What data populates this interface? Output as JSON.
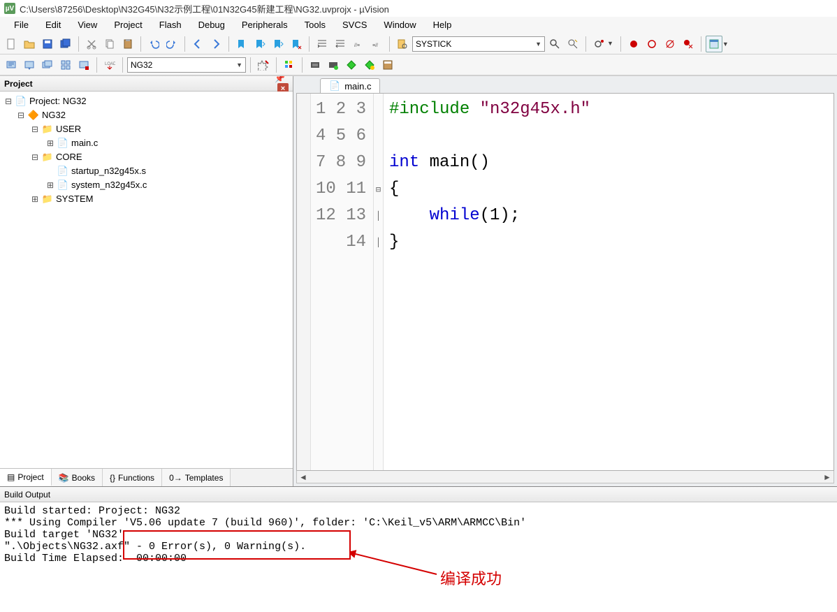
{
  "window": {
    "title": "C:\\Users\\87256\\Desktop\\N32G45\\N32示例工程\\01N32G45新建工程\\NG32.uvprojx - µVision"
  },
  "menu": {
    "items": [
      "File",
      "Edit",
      "View",
      "Project",
      "Flash",
      "Debug",
      "Peripherals",
      "Tools",
      "SVCS",
      "Window",
      "Help"
    ]
  },
  "toolbar1": {
    "combo_right": "SYSTICK"
  },
  "toolbar2": {
    "target_combo": "NG32"
  },
  "projectPanel": {
    "title": "Project",
    "tree": {
      "root": "Project: NG32",
      "target": "NG32",
      "groups": [
        {
          "name": "USER",
          "files": [
            "main.c"
          ]
        },
        {
          "name": "CORE",
          "files": [
            "startup_n32g45x.s",
            "system_n32g45x.c"
          ]
        },
        {
          "name": "SYSTEM",
          "files": []
        }
      ]
    },
    "tabs": [
      {
        "label": "Project",
        "icon": "project-icon",
        "active": true
      },
      {
        "label": "Books",
        "icon": "books-icon",
        "active": false
      },
      {
        "label": "Functions",
        "icon": "functions-icon",
        "active": false
      },
      {
        "label": "Templates",
        "icon": "templates-icon",
        "active": false
      }
    ]
  },
  "editor": {
    "activeFile": "main.c",
    "lineCount": 14,
    "code": {
      "l1_pre": "#include",
      "l1_str": "\"n32g45x.h\"",
      "l2": "",
      "l3_kw1": "int",
      "l3_id": " main()",
      "l4": "{",
      "l5_kw": "    while",
      "l5_rest": "(1);",
      "l6": "}",
      "l7": "",
      "l8": "",
      "l9": "",
      "l10": "",
      "l11": "",
      "l12": "",
      "l13": "",
      "l14": ""
    }
  },
  "buildOutput": {
    "title": "Build Output",
    "lines": [
      "Build started: Project: NG32",
      "*** Using Compiler 'V5.06 update 7 (build 960)', folder: 'C:\\Keil_v5\\ARM\\ARMCC\\Bin'",
      "Build target 'NG32'",
      "\".\\Objects\\NG32.axf\" - 0 Error(s), 0 Warning(s).",
      "Build Time Elapsed:  00:00:00"
    ],
    "annotation": "编译成功"
  }
}
